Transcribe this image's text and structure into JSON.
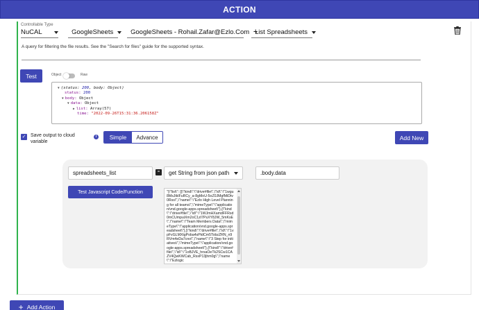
{
  "header": {
    "title": "ACTION"
  },
  "controllable": {
    "label": "Controllable Type",
    "value": "NuCAL"
  },
  "selectors": {
    "service": "GoogleSheets",
    "account": "GoogleSheets - Rohail.Zafar@Ezlo.Com",
    "method": "List Spreadsheets"
  },
  "icons": {
    "delete": "trash-icon",
    "sheet": "google-sheets-icon",
    "check": "checkmark-icon",
    "info": "info-icon",
    "add": "plus-icon"
  },
  "query_description": "A query for filtering the file results. See the \"Search for files\" guide for the supported syntax.",
  "test": {
    "button": "Test",
    "toggle_left": "Object",
    "toggle_right": "Raw"
  },
  "result": {
    "line1_pre": "(status: ",
    "line1_status": "200",
    "line1_mid": ", body: ",
    "line1_post": "Object)",
    "status_key": "status:",
    "status_val": "200",
    "body_key": "body:",
    "body_val": "Object",
    "data_key": "data:",
    "data_val": "Object",
    "list_key": "list:",
    "list_val": "Array(57)",
    "time_key": "time:",
    "time_val": "\"2022-09-26T15:31:36.206158Z\""
  },
  "save": {
    "label": "Save output to cloud variable",
    "simple": "Simple",
    "advance": "Advance",
    "add_new": "Add New"
  },
  "pipeline": {
    "variable_name": "spreadsheets_list",
    "operator_symbol": "=",
    "transform": "get String from json path",
    "json_path": ".body.data",
    "test_js_button": "Test Javascript Code/Function",
    "json_preview": "\"{\\\"list\\\": [{\\\"kind\\\":\\\"drive#file\\\",\\\"id\\\":\\\"1wgu8MsJtklFuRCy_a-8gMoU-5oZ0JMgfMiDtv0Rss\\\",\\\"name\\\":\\\"Ezlo High Level Planning for all teams\\\",\\\"mimeType\\\":\\\"application/vnd.google-apps.spreadsheet\\\"},{\\\"kind\\\":\\\"drive#file\\\",\\\"id\\\":\\\"1WJmHXamdFFRsd0mCUmpuiXm2oC1zI7PsXY8JW_5mKsE\\\",\\\"name\\\":\\\"Team Members Data\\\",\\\"mimeType\\\":\\\"application/vnd.google-apps.spreadsheet\\\"},{\\\"kind\\\":\\\"drive#file\\\",\\\"id\\\":\\\"1vpFvGLMXtgPoba4sPtdCm5TobzZRN_n9RVm4eDa7cno\\\",\\\"name\\\":\\\"3 Step for initiatives\\\",\\\"mimeType\\\":\\\"application/vnd.google-apps.spreadsheet\\\"},{\\\"kind\\\":\\\"drive#file\\\",\\\"id\\\":\\\"1oBJVE_hrsaOeTk2SCw1CAZV4QwKWCab_RsxP13jhm0g\\\",\\\"name\\\":\\\"Ezlogic"
  },
  "footer": {
    "add_action": "Add Action"
  },
  "colors": {
    "primary": "#3f47b5",
    "accent_green": "#2fb34c",
    "sheets_green": "#1e9e4a"
  }
}
